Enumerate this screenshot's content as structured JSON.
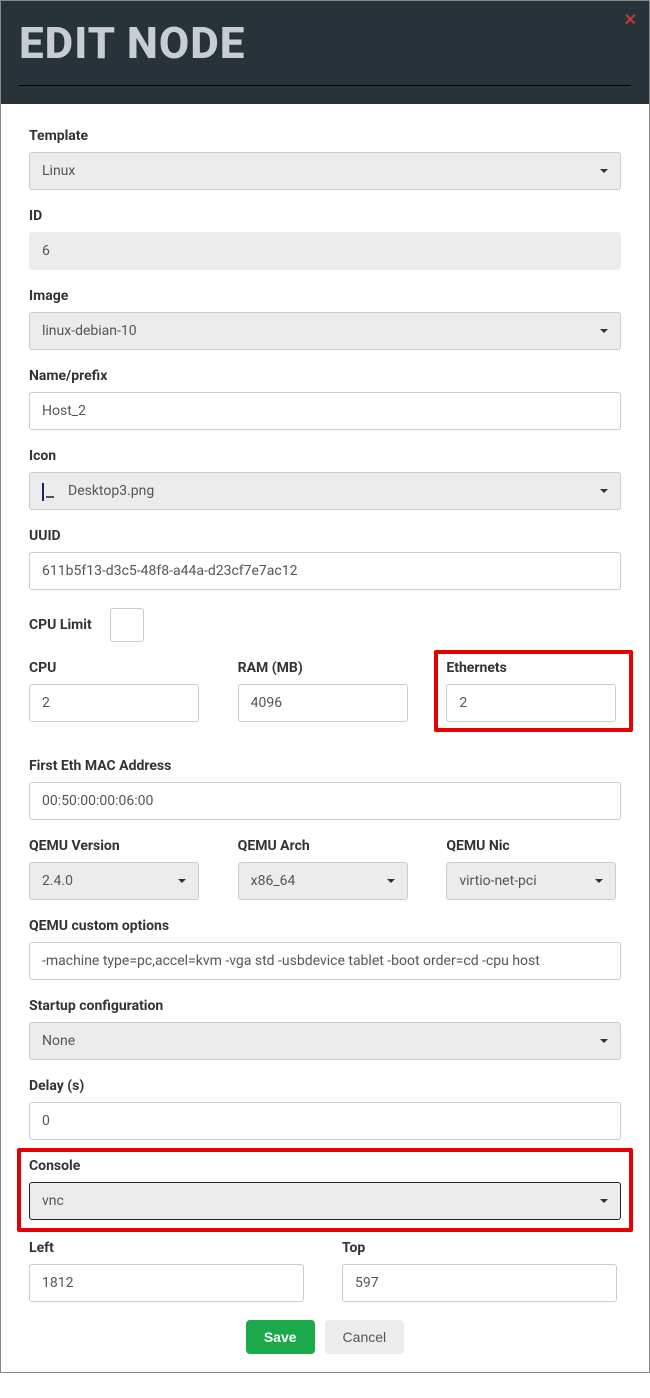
{
  "header": {
    "title": "EDIT NODE"
  },
  "labels": {
    "template": "Template",
    "id": "ID",
    "image": "Image",
    "name": "Name/prefix",
    "icon": "Icon",
    "uuid": "UUID",
    "cpu_limit": "CPU Limit",
    "cpu": "CPU",
    "ram": "RAM (MB)",
    "ethernets": "Ethernets",
    "first_mac": "First Eth MAC Address",
    "qemu_version": "QEMU Version",
    "qemu_arch": "QEMU Arch",
    "qemu_nic": "QEMU Nic",
    "qemu_custom": "QEMU custom options",
    "startup": "Startup configuration",
    "delay": "Delay (s)",
    "console": "Console",
    "left": "Left",
    "top": "Top"
  },
  "values": {
    "template": "Linux",
    "id": "6",
    "image": "linux-debian-10",
    "name": "Host_2",
    "icon": "Desktop3.png",
    "uuid": "611b5f13-d3c5-48f8-a44a-d23cf7e7ac12",
    "cpu": "2",
    "ram": "4096",
    "ethernets": "2",
    "first_mac": "00:50:00:00:06:00",
    "qemu_version": "2.4.0",
    "qemu_arch": "x86_64",
    "qemu_nic": "virtio-net-pci",
    "qemu_custom": "-machine type=pc,accel=kvm -vga std -usbdevice tablet -boot order=cd -cpu host",
    "startup": "None",
    "delay": "0",
    "console": "vnc",
    "left": "1812",
    "top": "597"
  },
  "buttons": {
    "save": "Save",
    "cancel": "Cancel"
  }
}
